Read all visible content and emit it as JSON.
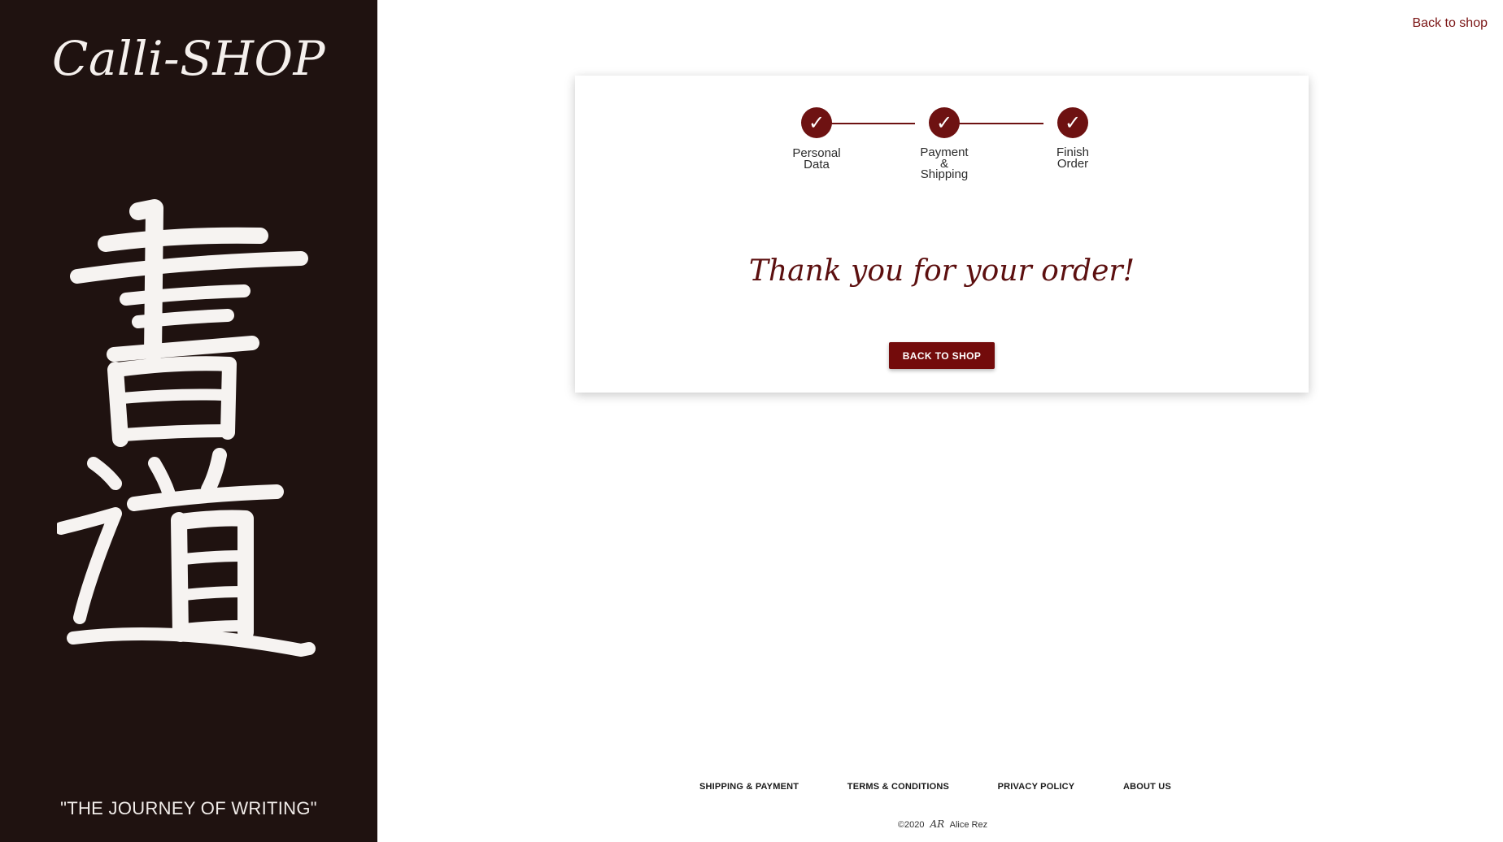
{
  "sidebar": {
    "brand": "Calli-SHOP",
    "tagline": "\"THE JOURNEY OF WRITING\"",
    "logo_text": "書道"
  },
  "header": {
    "back_link": "Back to shop"
  },
  "stepper": {
    "steps": [
      {
        "label_line1": "Personal",
        "label_line2": "Data",
        "label_line3": "",
        "icon": "check-icon",
        "completed": true
      },
      {
        "label_line1": "Payment",
        "label_line2": "&",
        "label_line3": "Shipping",
        "icon": "check-icon",
        "completed": true
      },
      {
        "label_line1": "Finish",
        "label_line2": "Order",
        "label_line3": "",
        "icon": "check-icon",
        "completed": true
      }
    ],
    "check_glyph": "✓"
  },
  "main": {
    "thanks": "Thank you for your order!",
    "button_label": "BACK TO SHOP"
  },
  "footer": {
    "links": [
      "SHIPPING & PAYMENT",
      "TERMS & CONDITIONS",
      "PRIVACY POLICY",
      "ABOUT US"
    ],
    "copyright_prefix": "©2020",
    "signature": "AR",
    "author": "Alice Rez"
  },
  "colors": {
    "sidebar_bg": "#1f1210",
    "accent": "#730b0b",
    "step": "#6e1212",
    "text_light": "#f5f0ed"
  }
}
